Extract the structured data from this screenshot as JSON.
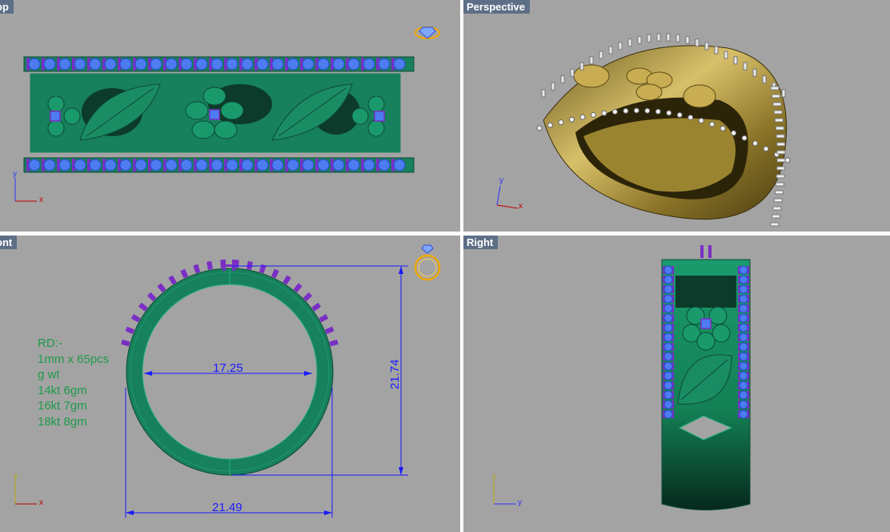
{
  "viewports": {
    "top": {
      "label": "op"
    },
    "perspective": {
      "label": "Perspective"
    },
    "front": {
      "label": "ont"
    },
    "right": {
      "label": "Right"
    }
  },
  "axes": {
    "top": {
      "v": "y",
      "h": "x"
    },
    "perspective": {
      "v": "y",
      "h": "x"
    },
    "front": {
      "v": "z",
      "h": "x"
    },
    "right": {
      "v": "z",
      "h": "y"
    }
  },
  "dimensions": {
    "inner_diameter": "17.25",
    "outer_width": "21.49",
    "height": "21.74"
  },
  "notes": [
    "RD:-",
    "1mm x 65pcs",
    "g wt",
    "14kt 6gm",
    "16kt 7gm",
    "18kt 8gm"
  ],
  "colors": {
    "viewport_bg": "#a3a3a3",
    "tab_bg": "#5d6f86",
    "band_green": "#17805c",
    "stone_blue": "#4c7cf0",
    "prong_purple": "#7a2fc4",
    "dimension_blue": "#1a1aff",
    "note_green": "#1f9a4a",
    "gold": "#b89a3a"
  },
  "icons": [
    "ring-icon",
    "gem-icon"
  ]
}
